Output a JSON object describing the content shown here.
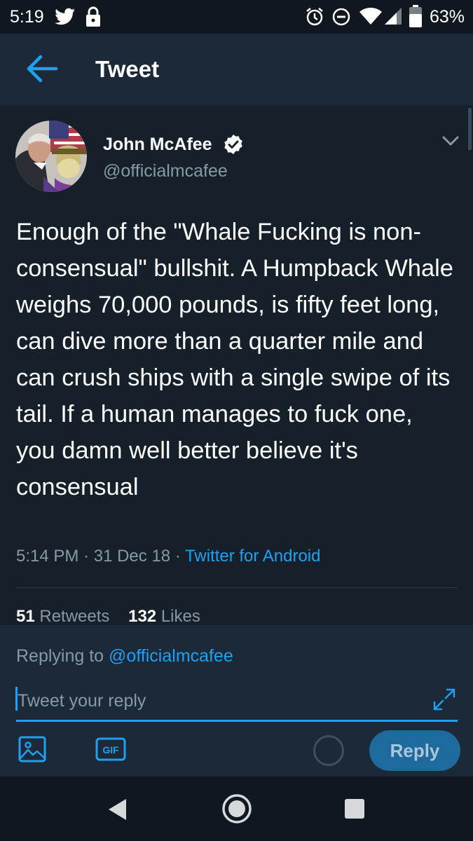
{
  "status_bar": {
    "time": "5:19",
    "battery": "63%",
    "icons": [
      "twitter-icon",
      "lock-icon",
      "alarm-icon",
      "do-not-disturb-icon",
      "wifi-icon",
      "signal-icon",
      "battery-icon"
    ]
  },
  "header": {
    "title": "Tweet",
    "back_icon": "arrow-left-icon"
  },
  "tweet": {
    "author_name": "John McAfee",
    "author_handle": "@officialmcafee",
    "verified": true,
    "text": "Enough of the \"Whale Fucking is non-consensual\" bullshit. A Humpback Whale weighs 70,000 pounds, is fifty feet long, can dive more than a quarter mile and can crush ships with a single swipe of its tail. If a human manages to fuck one, you damn well better believe it's consensual",
    "time": "5:14 PM",
    "date": "31 Dec 18",
    "separator": "·",
    "source": "Twitter for Android",
    "retweets_count": "51",
    "retweets_label": "Retweets",
    "likes_count": "132",
    "likes_label": "Likes"
  },
  "composer": {
    "replying_prefix": "Replying to",
    "replying_handle": "@officialmcafee",
    "placeholder": "Tweet your reply",
    "reply_label": "Reply",
    "gif_label": "GIF"
  },
  "colors": {
    "background": "#15202b",
    "header_bg": "#1c2938",
    "accent": "#1da1f2",
    "secondary_text": "#8899a6",
    "reply_button_bg": "#1e6a9d"
  }
}
